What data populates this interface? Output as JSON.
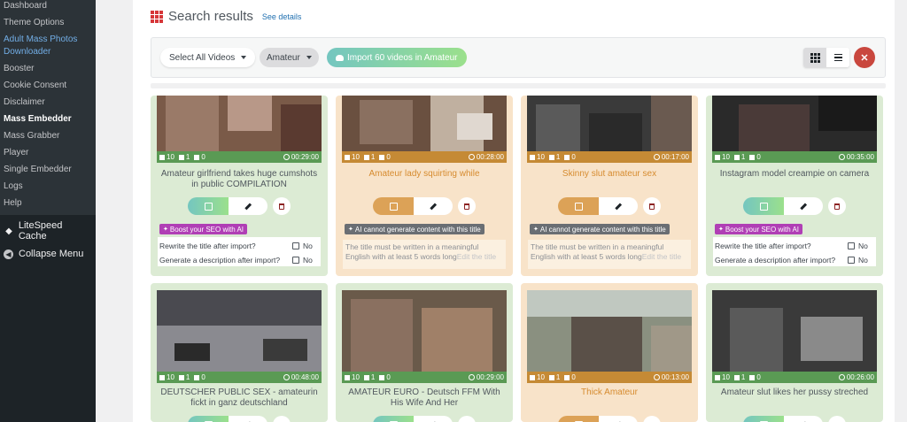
{
  "sidebar": {
    "sub_items": [
      {
        "label": "Dashboard",
        "state": "normal"
      },
      {
        "label": "Theme Options",
        "state": "normal"
      },
      {
        "label": "Adult Mass Photos Downloader",
        "state": "blue"
      },
      {
        "label": "Booster",
        "state": "normal"
      },
      {
        "label": "Cookie Consent",
        "state": "normal"
      },
      {
        "label": "Disclaimer",
        "state": "normal"
      },
      {
        "label": "Mass Embedder",
        "state": "active"
      },
      {
        "label": "Mass Grabber",
        "state": "normal"
      },
      {
        "label": "Player",
        "state": "normal"
      },
      {
        "label": "Single Embedder",
        "state": "normal"
      },
      {
        "label": "Logs",
        "state": "normal"
      },
      {
        "label": "Help",
        "state": "normal"
      }
    ],
    "litespeed": "LiteSpeed Cache",
    "collapse": "Collapse Menu"
  },
  "header": {
    "title": "Search results",
    "see_details": "See details"
  },
  "toolbar": {
    "select_label": "Select All Videos",
    "category_label": "Amateur",
    "import_label": "Import 60 videos in Amateur"
  },
  "cards": [
    {
      "title": "Amateur girlfriend takes huge cumshots in public COMPILATION",
      "views": "10",
      "pages": "1",
      "likes": "0",
      "duration": "00:29:00",
      "theme": "green",
      "seo": "Boost your SEO with AI"
    },
    {
      "title": "Amateur lady squirting while",
      "views": "10",
      "pages": "1",
      "likes": "0",
      "duration": "00:28:00",
      "theme": "orange",
      "seo": "AI cannot generate content with this title"
    },
    {
      "title": "Skinny slut amateur sex",
      "views": "10",
      "pages": "1",
      "likes": "0",
      "duration": "00:17:00",
      "theme": "orange",
      "seo": "AI cannot generate content with this title"
    },
    {
      "title": "Instagram model creampie on camera",
      "views": "10",
      "pages": "1",
      "likes": "0",
      "duration": "00:35:00",
      "theme": "green",
      "seo": "Boost your SEO with AI"
    },
    {
      "title": "DEUTSCHER PUBLIC SEX - amateurin fickt in ganz deutschland",
      "views": "10",
      "pages": "1",
      "likes": "0",
      "duration": "00:48:00",
      "theme": "green"
    },
    {
      "title": "AMATEUR EURO - Deutsch FFM With His Wife And Her",
      "views": "10",
      "pages": "1",
      "likes": "0",
      "duration": "00:29:00",
      "theme": "green"
    },
    {
      "title": "Thick Amateur",
      "views": "10",
      "pages": "1",
      "likes": "0",
      "duration": "00:13:00",
      "theme": "orange"
    },
    {
      "title": "Amateur slut likes her pussy streched",
      "views": "10",
      "pages": "1",
      "likes": "0",
      "duration": "00:26:00",
      "theme": "green"
    }
  ],
  "options": {
    "rewrite": "Rewrite the title after import?",
    "describe": "Generate a description after import?",
    "no": "No"
  },
  "warning": {
    "text": "The title must be written in a meaningful English with at least 5 words long",
    "edit_link": "Edit the title"
  },
  "colors": {
    "sidebar_bg": "#1d2327",
    "card_green": "#dcebd4",
    "card_orange": "#f8e3c9",
    "accent_red": "#d63638",
    "seo_purple": "#b03fb5"
  }
}
